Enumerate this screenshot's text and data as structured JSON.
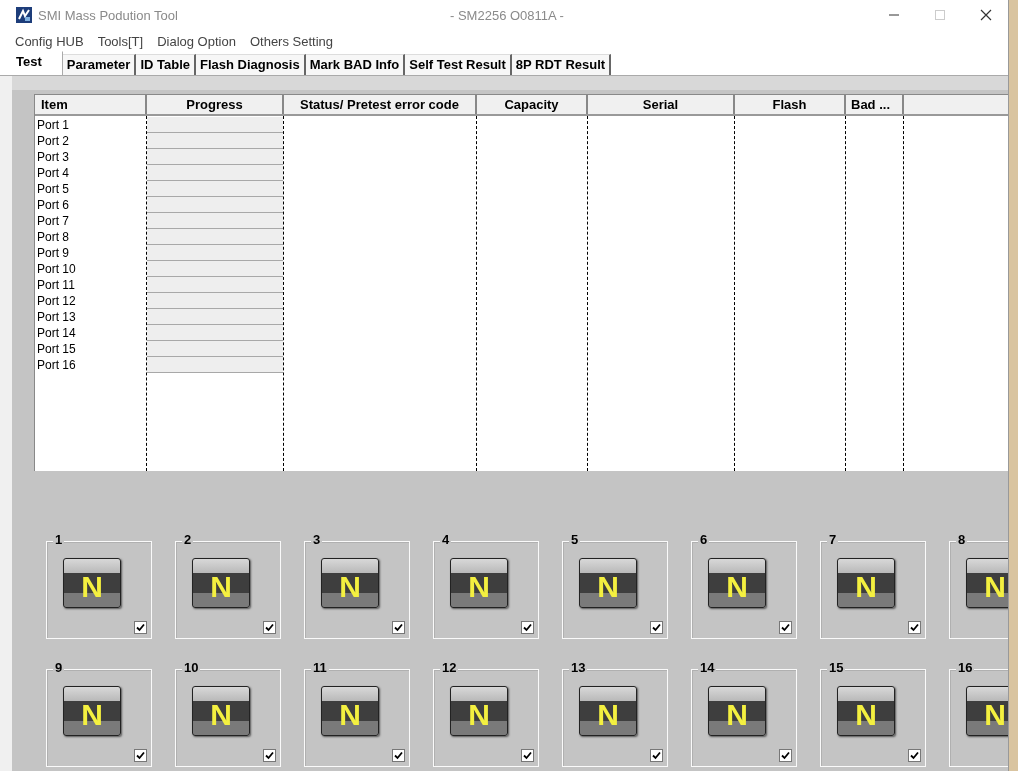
{
  "window": {
    "title": "SMI Mass Podution Tool",
    "subtitle": "- SM2256 O0811A -"
  },
  "menu": [
    "Config HUB",
    "Tools[T]",
    "Dialog Option",
    "Others Setting"
  ],
  "tabs": [
    {
      "label": "Test",
      "selected": true
    },
    {
      "label": "Parameter",
      "selected": false
    },
    {
      "label": "ID Table",
      "selected": false
    },
    {
      "label": "Flash Diagnosis",
      "selected": false
    },
    {
      "label": "Mark BAD Info",
      "selected": false
    },
    {
      "label": "Self Test Result",
      "selected": false
    },
    {
      "label": "8P RDT Result",
      "selected": false
    }
  ],
  "table": {
    "columns": [
      "Item",
      "Progress",
      "Status/ Pretest error code",
      "Capacity",
      "Serial",
      "Flash",
      "Bad ..."
    ],
    "rows": [
      {
        "item": "Port 1",
        "level": 0
      },
      {
        "item": "Port 2",
        "level": 0
      },
      {
        "item": "Port 3",
        "level": 0
      },
      {
        "item": "Port 4",
        "level": 0
      },
      {
        "item": "Port 5",
        "level": 0
      },
      {
        "item": "Port 6",
        "level": 0
      },
      {
        "item": "Port 7",
        "level": 0
      },
      {
        "item": "Port 8",
        "level": 0
      },
      {
        "item": "Port 9",
        "level": 0
      },
      {
        "item": "Port 10",
        "level": 0
      },
      {
        "item": "Port 11",
        "level": 0
      },
      {
        "item": "Port 12",
        "level": 0
      },
      {
        "item": "Port 13",
        "level": 0
      },
      {
        "item": "Port 14",
        "level": 0
      },
      {
        "item": "Port 15",
        "level": 0
      },
      {
        "item": "Port 16",
        "level": 0
      }
    ]
  },
  "ports": [
    {
      "number": "1",
      "status": "N",
      "checked": true
    },
    {
      "number": "2",
      "status": "N",
      "checked": true
    },
    {
      "number": "3",
      "status": "N",
      "checked": true
    },
    {
      "number": "4",
      "status": "N",
      "checked": true
    },
    {
      "number": "5",
      "status": "N",
      "checked": true
    },
    {
      "number": "6",
      "status": "N",
      "checked": true
    },
    {
      "number": "7",
      "status": "N",
      "checked": true
    },
    {
      "number": "8",
      "status": "N"
    },
    {
      "number": "9",
      "status": "N",
      "checked": true
    },
    {
      "number": "10",
      "status": "N",
      "checked": true
    },
    {
      "number": "11",
      "status": "N",
      "checked": true
    },
    {
      "number": "12",
      "status": "N",
      "checked": true
    },
    {
      "number": "13",
      "status": "N",
      "checked": true
    },
    {
      "number": "14",
      "status": "N",
      "checked": true
    },
    {
      "number": "15",
      "status": "N",
      "checked": true
    },
    {
      "number": "16",
      "status": "N"
    }
  ]
}
